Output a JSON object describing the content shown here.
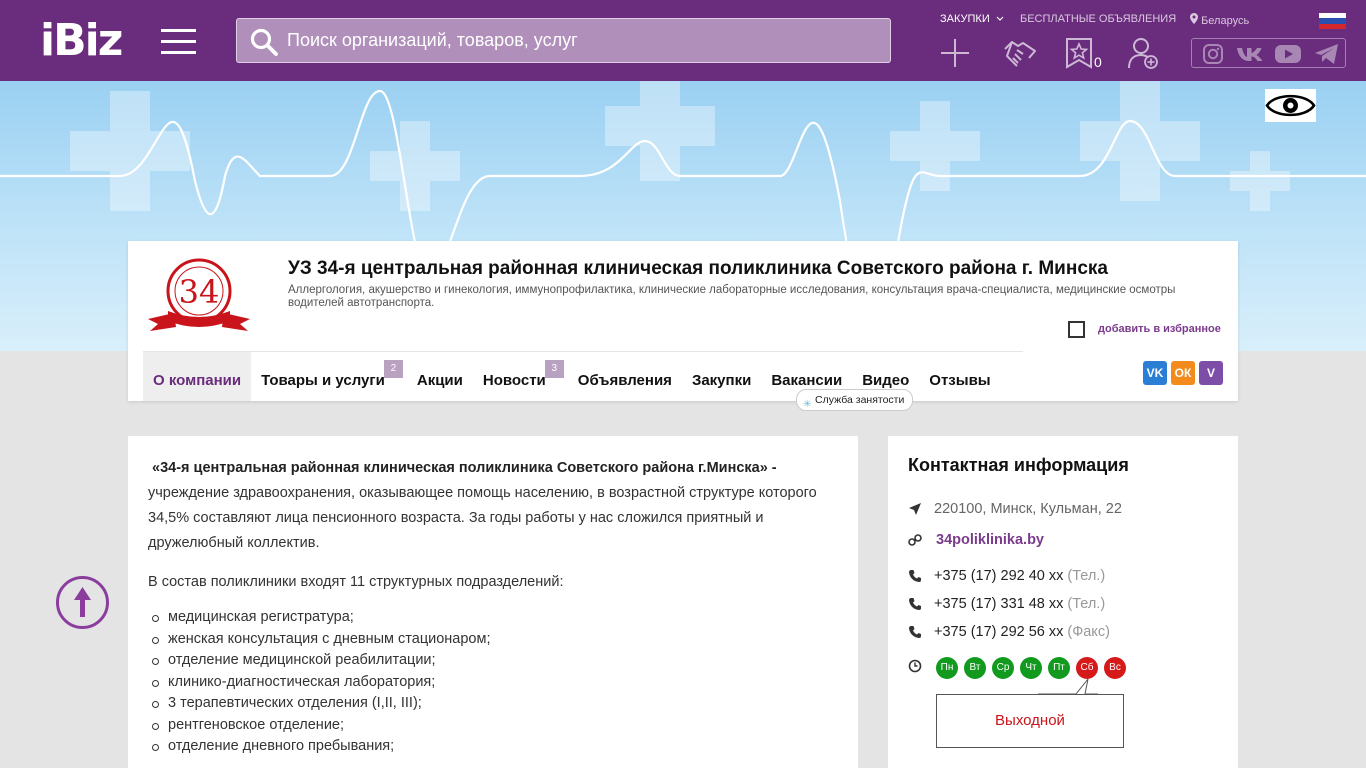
{
  "header": {
    "logo": "iBiz",
    "search_placeholder": "Поиск организаций, товаров, услуг",
    "links": {
      "purchases": "ЗАКУПКИ",
      "free_ads": "БЕСПЛАТНЫЕ ОБЪЯВЛЕНИЯ",
      "region": "Беларусь"
    },
    "favorites_count": "0"
  },
  "company": {
    "title": "УЗ 34-я центральная районная клиническая поликлиника Советского района г. Минска",
    "description": "Аллергология, акушерство и гинекология, иммунопрофилактика, клинические лабораторные исследования, консультация врача-специалиста, медицинские осмотры водителей автотранспорта.",
    "add_favorite": "добавить в избранное",
    "logo_number": "34",
    "tabs": [
      {
        "label": "О компании"
      },
      {
        "label": "Товары и услуги",
        "count": "2"
      },
      {
        "label": "Акции"
      },
      {
        "label": "Новости",
        "count": "3"
      },
      {
        "label": "Объявления"
      },
      {
        "label": "Закупки"
      },
      {
        "label": "Вакансии"
      },
      {
        "label": "Видео"
      },
      {
        "label": "Отзывы"
      }
    ],
    "employment_badge": "Служба занятости",
    "share": {
      "vk": "VK",
      "ok": "ОК",
      "viber": "V"
    }
  },
  "about": {
    "lead_bold": "«34-я центральная районная клиническая поликлиника Советского района г.Минска» -",
    "lead_rest": "учреждение здравоохранения, оказывающее помощь населению, в возрастной структуре которого 34,5% составляют лица пенсионного возраста. За годы работы у нас сложился приятный и дружелюбный коллектив.",
    "intro": "В состав поликлиники входят 11 структурных подразделений:",
    "items": [
      "медицинская регистратура;",
      "женская консультация с дневным стационаром;",
      "отделение медицинской реабилитации;",
      "клинико-диагностическая лаборатория;",
      "3 терапевтических отделения (I,II, III);",
      "рентгеновское отделение;",
      "отделение дневного пребывания;"
    ]
  },
  "contact": {
    "title": "Контактная информация",
    "address": "220100, Минск, Кульман, 22",
    "website": "34poliklinika.by",
    "phones": [
      {
        "number": "+375 (17) 292 40 xx",
        "type": "(Тел.)"
      },
      {
        "number": "+375 (17) 331 48 xx",
        "type": "(Тел.)"
      },
      {
        "number": "+375 (17) 292 56 xx",
        "type": "(Факс)"
      }
    ],
    "days": [
      {
        "label": "Пн",
        "status": "on"
      },
      {
        "label": "Вт",
        "status": "on"
      },
      {
        "label": "Ср",
        "status": "on"
      },
      {
        "label": "Чт",
        "status": "on"
      },
      {
        "label": "Пт",
        "status": "on"
      },
      {
        "label": "Сб",
        "status": "off"
      },
      {
        "label": "Вс",
        "status": "off"
      }
    ],
    "day_off_label": "Выходной"
  },
  "colors": {
    "brand": "#6a2c7c",
    "link": "#7b3b8c",
    "open": "#119a1e",
    "closed": "#d61a1a"
  }
}
